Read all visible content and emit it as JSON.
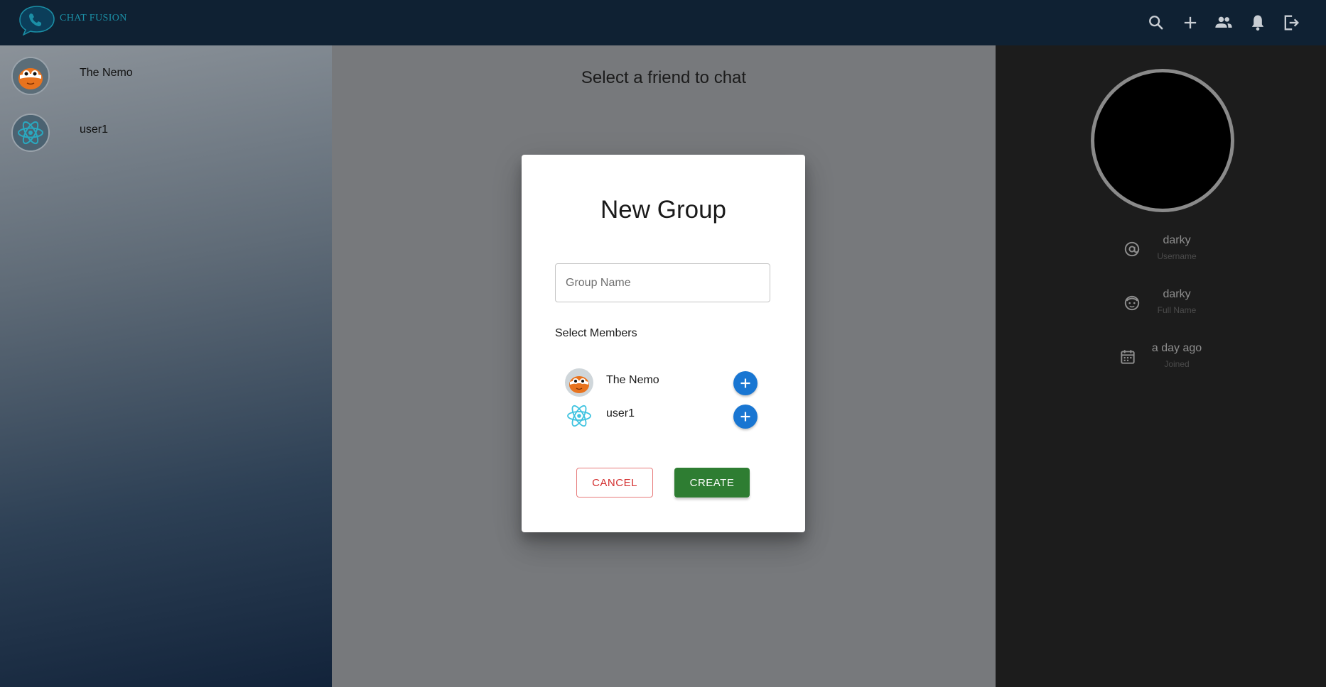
{
  "app": {
    "logo_text": "CHAT FUSION",
    "toolbar_icons": [
      "search-icon",
      "add-icon",
      "group-icon",
      "notifications-icon",
      "logout-icon"
    ]
  },
  "sidebar": {
    "contacts": [
      {
        "name": "The Nemo",
        "avatar": "clownfish-avatar"
      },
      {
        "name": "user1",
        "avatar": "react-logo-avatar"
      }
    ]
  },
  "main": {
    "placeholder_title": "Select a friend to chat"
  },
  "profile": {
    "fields": [
      {
        "value": "darky",
        "label": "Username",
        "icon": "at-sign-icon"
      },
      {
        "value": "darky",
        "label": "Full Name",
        "icon": "face-icon"
      },
      {
        "value": "a day ago",
        "label": "Joined",
        "icon": "calendar-icon"
      }
    ]
  },
  "dialog": {
    "title": "New Group",
    "group_name_placeholder": "Group Name",
    "group_name_value": "",
    "select_members_label": "Select Members",
    "members": [
      {
        "name": "The Nemo",
        "avatar": "clownfish-avatar"
      },
      {
        "name": "user1",
        "avatar": "react-logo-avatar"
      }
    ],
    "cancel_label": "CANCEL",
    "create_label": "CREATE"
  },
  "colors": {
    "topbar": "#0f2133",
    "primary_blue": "#1976d2",
    "create_green": "#2e7d32",
    "cancel_red": "#d32f2f",
    "profile_panel": "#1c1c1c"
  }
}
